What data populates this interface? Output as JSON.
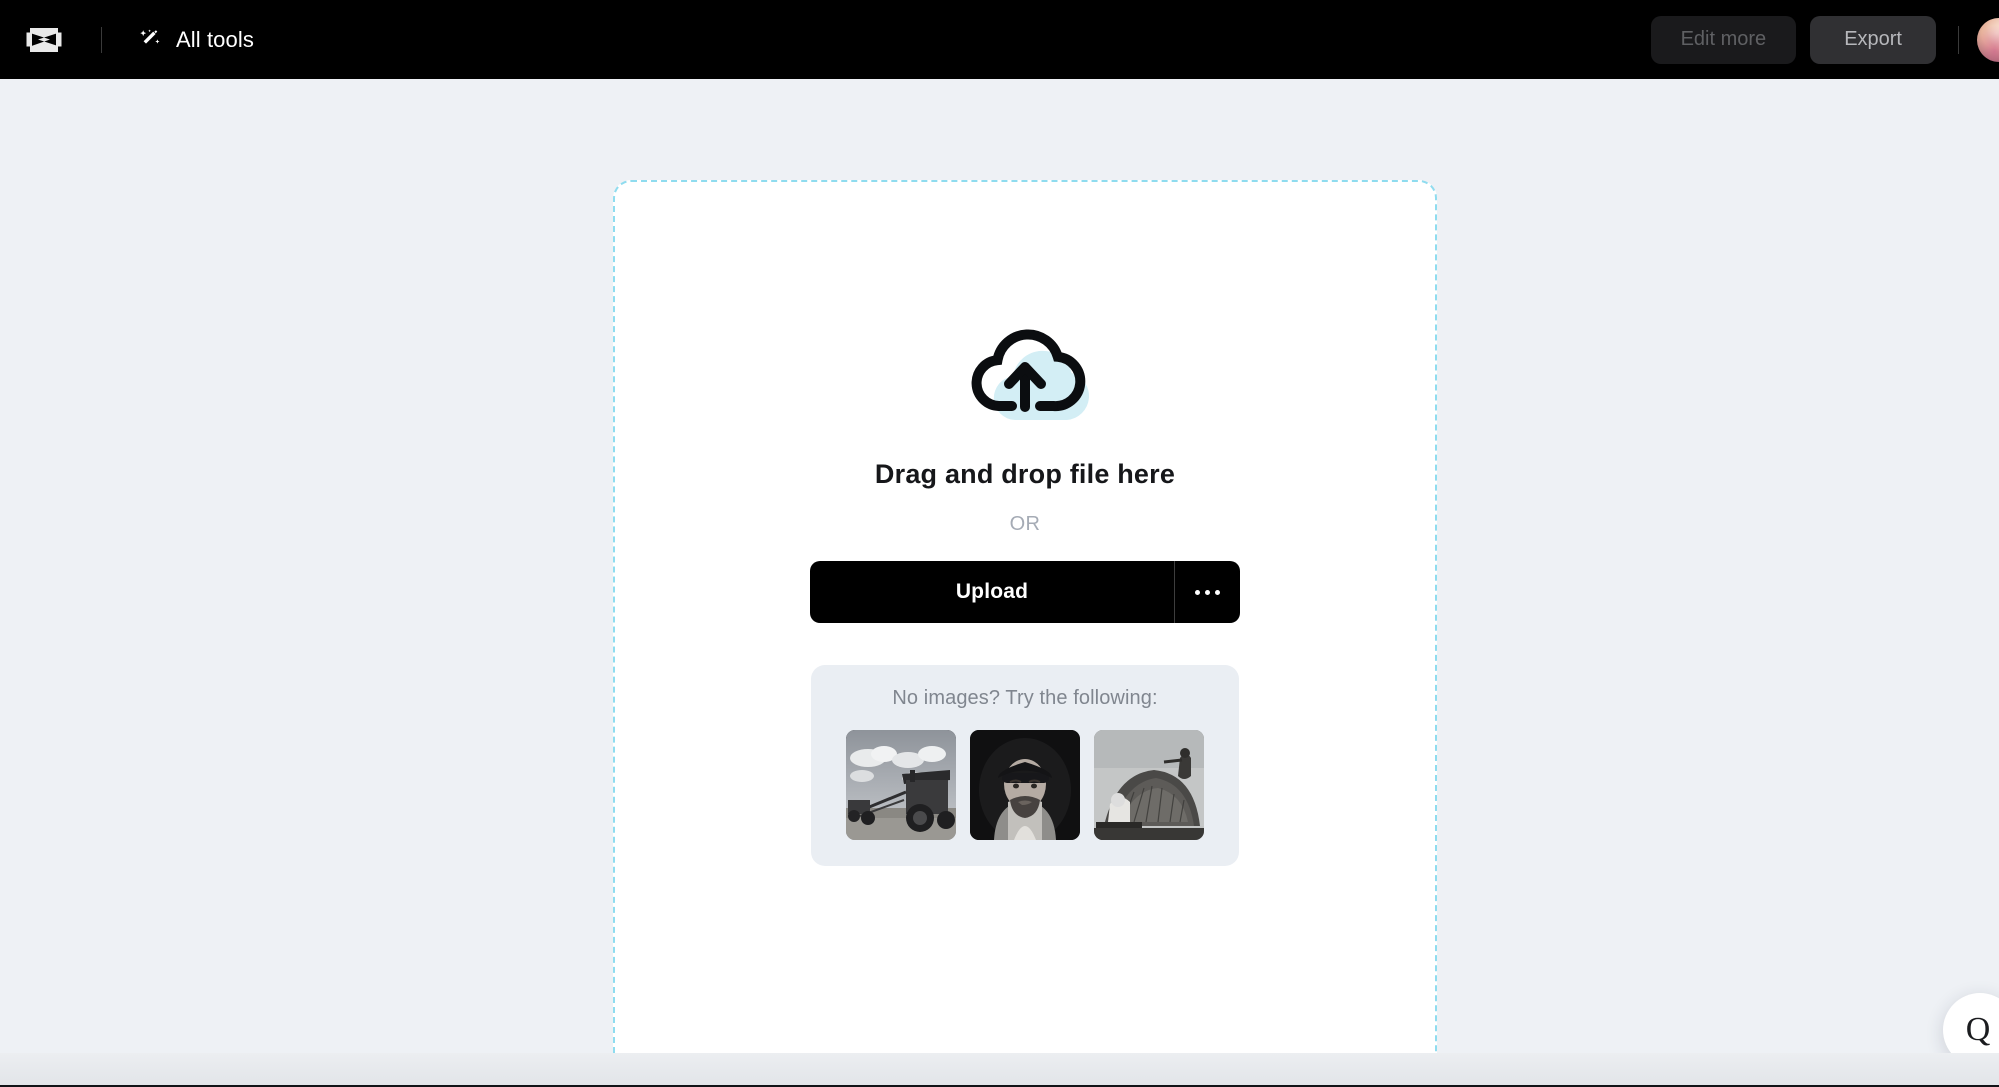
{
  "header": {
    "logo_icon": "capcut-logo-icon",
    "all_tools": {
      "icon": "magic-wand-icon",
      "label": "All tools"
    },
    "edit_more_label": "Edit more",
    "export_label": "Export",
    "avatar_alt": "user-avatar"
  },
  "dropzone": {
    "icon": "cloud-upload-icon",
    "title": "Drag and drop file here",
    "or_label": "OR",
    "upload_button_label": "Upload",
    "more_options_icon": "ellipsis-icon",
    "samples": {
      "title": "No images? Try the following:",
      "items": [
        {
          "name": "sample-image-farm-machine",
          "caption": ""
        },
        {
          "name": "sample-image-portrait-man",
          "caption": ""
        },
        {
          "name": "sample-image-haystack",
          "caption": ""
        }
      ]
    }
  },
  "help": {
    "icon": "help-chat-icon",
    "glyph": "Q"
  },
  "colors": {
    "page_background": "#eef1f5",
    "topbar_background": "#000000",
    "dropzone_border": "#8fdcef",
    "dropzone_fill": "#ffffff",
    "accent_cloud": "#d3eef5",
    "upload_button": "#000000",
    "samples_panel": "#eaeef3"
  }
}
